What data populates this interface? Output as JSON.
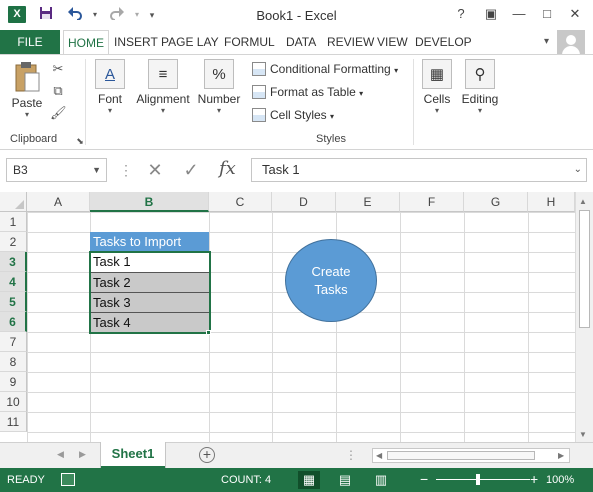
{
  "window": {
    "title": "Book1 - Excel",
    "app_logo": "X",
    "help": "?",
    "restore_ribbon": "▣",
    "minimize": "—",
    "maximize": "□",
    "close": "✕"
  },
  "quick_access": {
    "save_icon": "floppy-disk-icon",
    "undo_icon": "undo-icon",
    "redo_icon": "redo-icon",
    "customize_icon": "dropdown-icon"
  },
  "ribbon_tabs": {
    "file": "FILE",
    "items": [
      "HOME",
      "INSERT",
      "PAGE LAY",
      "FORMUL",
      "DATA",
      "REVIEW",
      "VIEW",
      "DEVELOP"
    ],
    "active": "HOME"
  },
  "ribbon": {
    "clipboard": {
      "paste": "Paste",
      "group_label": "Clipboard"
    },
    "font": {
      "label": "Font",
      "icon_text": "A"
    },
    "alignment": {
      "label": "Alignment"
    },
    "number": {
      "label": "Number",
      "icon_text": "%"
    },
    "styles": {
      "conditional_formatting": "Conditional Formatting",
      "format_as_table": "Format as Table",
      "cell_styles": "Cell Styles",
      "group_label": "Styles"
    },
    "cells": {
      "label": "Cells"
    },
    "editing": {
      "label": "Editing"
    }
  },
  "formula_bar": {
    "name_box": "B3",
    "fx": "fx",
    "content": "Task 1"
  },
  "grid": {
    "columns": [
      "A",
      "B",
      "C",
      "D",
      "E",
      "F",
      "G",
      "H"
    ],
    "selected_column": "B",
    "rows": [
      "1",
      "2",
      "3",
      "4",
      "5",
      "6",
      "7",
      "8",
      "9",
      "10",
      "11"
    ],
    "selected_rows": [
      "3",
      "4",
      "5",
      "6"
    ],
    "cells": {
      "B2": "Tasks to Import",
      "B3": "Task 1",
      "B4": "Task 2",
      "B5": "Task 3",
      "B6": "Task 4"
    },
    "shape_text": "Create Tasks",
    "colors": {
      "header_fill": "#5b9bd5",
      "shaded_fill": "#c9c9c9",
      "selection": "#217346",
      "shape_fill": "#5b9bd5"
    }
  },
  "sheet_tabs": {
    "sheets": [
      "Sheet1"
    ],
    "active": "Sheet1",
    "add_icon": "plus-circle-icon"
  },
  "status_bar": {
    "ready": "READY",
    "count": "COUNT: 4",
    "zoom": "100%",
    "zoom_level": 1.0,
    "colors": {
      "background": "#217346"
    }
  }
}
